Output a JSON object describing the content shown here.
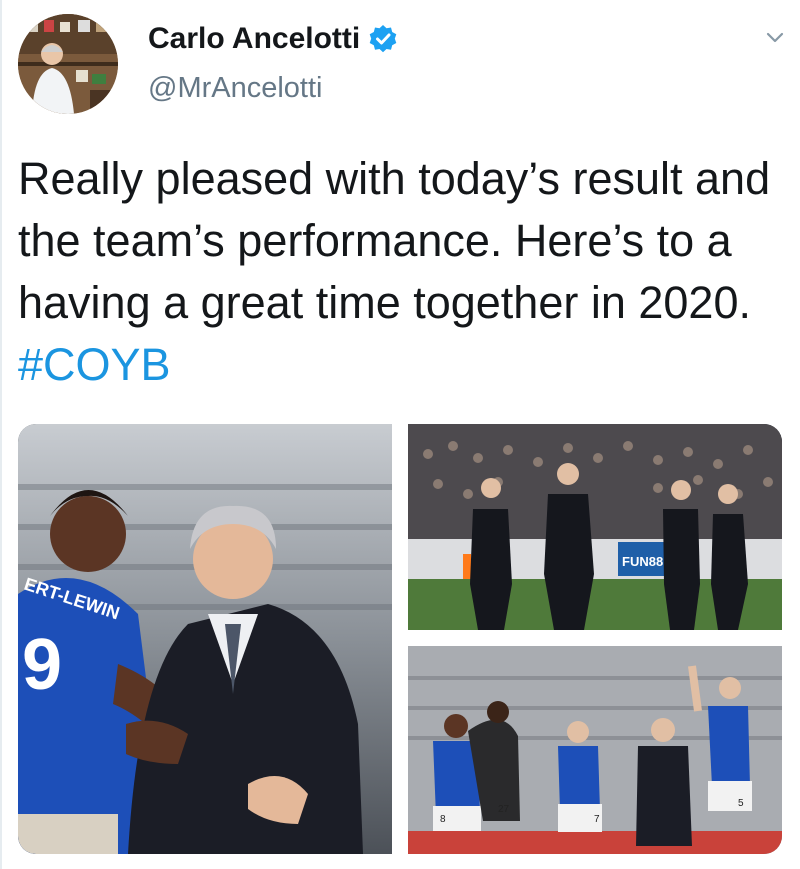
{
  "tweet": {
    "display_name": "Carlo Ancelotti",
    "handle": "@MrAncelotti",
    "verified": true,
    "text_before_hashtag": "Really pleased with today’s result and the team’s performance. Here’s to a having a great time together in 2020. ",
    "hashtag": "#COYB",
    "menu_icon": "chevron-down-icon"
  },
  "media": {
    "photo_1": {
      "shirt_text": "ERT-LEWIN",
      "shirt_number": "9"
    },
    "photo_2": {
      "board_text": "FUN88"
    },
    "photo_3": {
      "numbers": [
        "8",
        "27",
        "7",
        "5"
      ]
    }
  },
  "colors": {
    "link": "#1b95e0",
    "handle_gray": "#657786",
    "verified_blue": "#1da1f2",
    "everton_blue": "#1d4fb8"
  }
}
